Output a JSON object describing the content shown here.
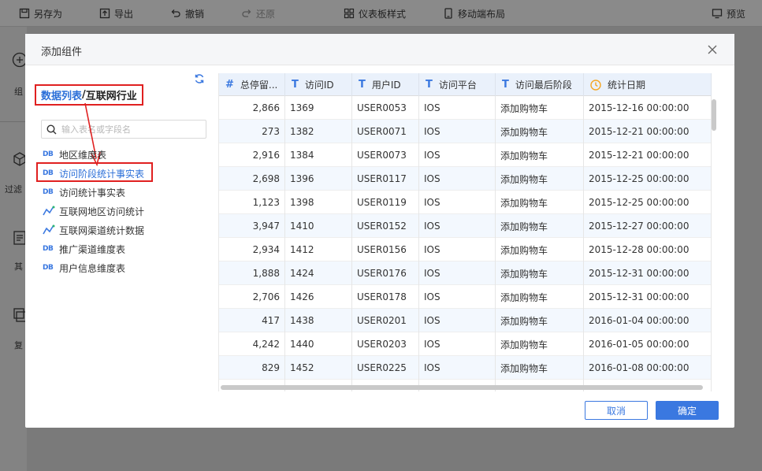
{
  "toolbar": {
    "save_as": "另存为",
    "export": "导出",
    "undo": "撤销",
    "redo": "还原",
    "dashboard_style": "仪表板样式",
    "mobile_layout": "移动端布局",
    "preview": "预览"
  },
  "leftstrip": {
    "item1": "组",
    "item2": "过滤",
    "item3": "其",
    "item4": "复"
  },
  "modal": {
    "title": "添加组件",
    "breadcrumb_link": "数据列表",
    "breadcrumb_sep": "/",
    "breadcrumb_current": "互联网行业",
    "search_placeholder": "输入表名或字段名",
    "tree": [
      {
        "label": "地区维度表",
        "icon": "db"
      },
      {
        "label": "访问阶段统计事实表",
        "icon": "db",
        "selected": true
      },
      {
        "label": "访问统计事实表",
        "icon": "db"
      },
      {
        "label": "互联网地区访问统计",
        "icon": "etl"
      },
      {
        "label": "互联网渠道统计数据",
        "icon": "etl"
      },
      {
        "label": "推广渠道维度表",
        "icon": "db"
      },
      {
        "label": "用户信息维度表",
        "icon": "db"
      }
    ],
    "columns": [
      {
        "type": "#",
        "label": "总停留..."
      },
      {
        "type": "T",
        "label": "访问ID"
      },
      {
        "type": "T",
        "label": "用户ID"
      },
      {
        "type": "T",
        "label": "访问平台"
      },
      {
        "type": "T",
        "label": "访问最后阶段"
      },
      {
        "type": "clock",
        "label": "统计日期"
      }
    ],
    "rows": [
      [
        "2,866",
        "1369",
        "USER0053",
        "IOS",
        "添加购物车",
        "2015-12-16 00:00:00"
      ],
      [
        "273",
        "1382",
        "USER0071",
        "IOS",
        "添加购物车",
        "2015-12-21 00:00:00"
      ],
      [
        "2,916",
        "1384",
        "USER0073",
        "IOS",
        "添加购物车",
        "2015-12-21 00:00:00"
      ],
      [
        "2,698",
        "1396",
        "USER0117",
        "IOS",
        "添加购物车",
        "2015-12-25 00:00:00"
      ],
      [
        "1,123",
        "1398",
        "USER0119",
        "IOS",
        "添加购物车",
        "2015-12-25 00:00:00"
      ],
      [
        "3,947",
        "1410",
        "USER0152",
        "IOS",
        "添加购物车",
        "2015-12-27 00:00:00"
      ],
      [
        "2,934",
        "1412",
        "USER0156",
        "IOS",
        "添加购物车",
        "2015-12-28 00:00:00"
      ],
      [
        "1,888",
        "1424",
        "USER0176",
        "IOS",
        "添加购物车",
        "2015-12-31 00:00:00"
      ],
      [
        "2,706",
        "1426",
        "USER0178",
        "IOS",
        "添加购物车",
        "2015-12-31 00:00:00"
      ],
      [
        "417",
        "1438",
        "USER0201",
        "IOS",
        "添加购物车",
        "2016-01-04 00:00:00"
      ],
      [
        "4,242",
        "1440",
        "USER0203",
        "IOS",
        "添加购物车",
        "2016-01-05 00:00:00"
      ],
      [
        "829",
        "1452",
        "USER0225",
        "IOS",
        "添加购物车",
        "2016-01-08 00:00:00"
      ],
      [
        "",
        "",
        "",
        "",
        "",
        ""
      ]
    ],
    "cancel_label": "取消",
    "ok_label": "确定"
  },
  "colors": {
    "accent": "#3a78e0",
    "highlight_border": "#e02020",
    "header_bg": "#eaf1fb",
    "row_alt": "#f3f8fe"
  }
}
